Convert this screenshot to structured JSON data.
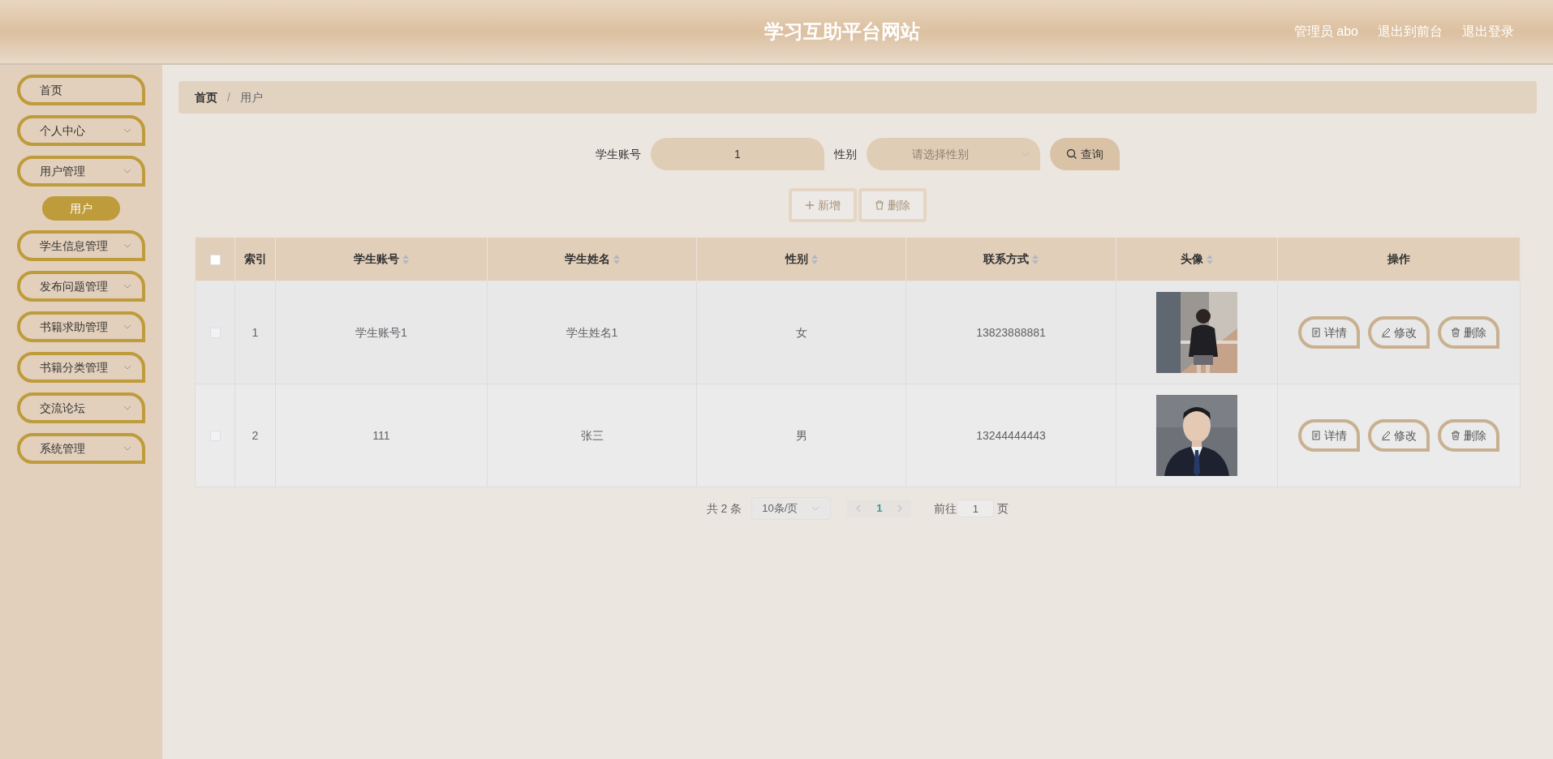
{
  "header": {
    "title": "学习互助平台网站",
    "user": "管理员 abo",
    "links": [
      "退出到前台",
      "退出登录"
    ]
  },
  "sidebar": {
    "items": [
      {
        "kind": "link",
        "label": "首页"
      },
      {
        "kind": "menu",
        "label": "个人中心"
      },
      {
        "kind": "menu",
        "label": "用户管理",
        "children": [
          {
            "label": "用户",
            "selected": true
          }
        ]
      },
      {
        "kind": "menu",
        "label": "学生信息管理"
      },
      {
        "kind": "menu",
        "label": "发布问题管理"
      },
      {
        "kind": "menu",
        "label": "书籍求助管理"
      },
      {
        "kind": "menu",
        "label": "书籍分类管理"
      },
      {
        "kind": "menu",
        "label": "交流论坛"
      },
      {
        "kind": "menu",
        "label": "系统管理"
      }
    ]
  },
  "breadcrumb": [
    "首页",
    "用户"
  ],
  "breadcrumb_separator": "/",
  "search": {
    "fields": [
      {
        "kind": "input",
        "label": "学生账号",
        "value": "1"
      },
      {
        "kind": "select",
        "label": "性别",
        "placeholder": "请选择性别"
      }
    ],
    "button": "查询"
  },
  "actions": [
    {
      "kind": "add",
      "label": "新增",
      "disabled": true
    },
    {
      "kind": "delete",
      "label": "删除",
      "disabled": true
    }
  ],
  "table": {
    "all_checked": false,
    "columns": [
      {
        "label": "索引",
        "sortable": false
      },
      {
        "label": "学生账号",
        "sortable": true
      },
      {
        "label": "学生姓名",
        "sortable": true
      },
      {
        "label": "性别",
        "sortable": true
      },
      {
        "label": "联系方式",
        "sortable": true
      },
      {
        "label": "头像",
        "sortable": true
      },
      {
        "label": "操作",
        "sortable": false
      }
    ],
    "rows": [
      {
        "checked": false,
        "index": "1",
        "account": "学生账号1",
        "name": "学生姓名1",
        "gender": "女",
        "phone": "13823888881",
        "buttons": [
          {
            "kind": "detail",
            "label": "详情"
          },
          {
            "kind": "edit",
            "label": "修改"
          },
          {
            "kind": "delete",
            "label": "删除"
          }
        ]
      },
      {
        "checked": false,
        "index": "2",
        "account": "111",
        "name": "张三",
        "gender": "男",
        "phone": "13244444443",
        "buttons": [
          {
            "kind": "detail",
            "label": "详情"
          },
          {
            "kind": "edit",
            "label": "修改"
          },
          {
            "kind": "delete",
            "label": "删除"
          }
        ]
      }
    ]
  },
  "pagination": {
    "total": "共 2 条",
    "page_size": "10条/页",
    "pages": [
      {
        "label": "1",
        "selected": true
      }
    ],
    "goto_label": "前往",
    "goto_value": "1",
    "goto_suffix": "页"
  }
}
